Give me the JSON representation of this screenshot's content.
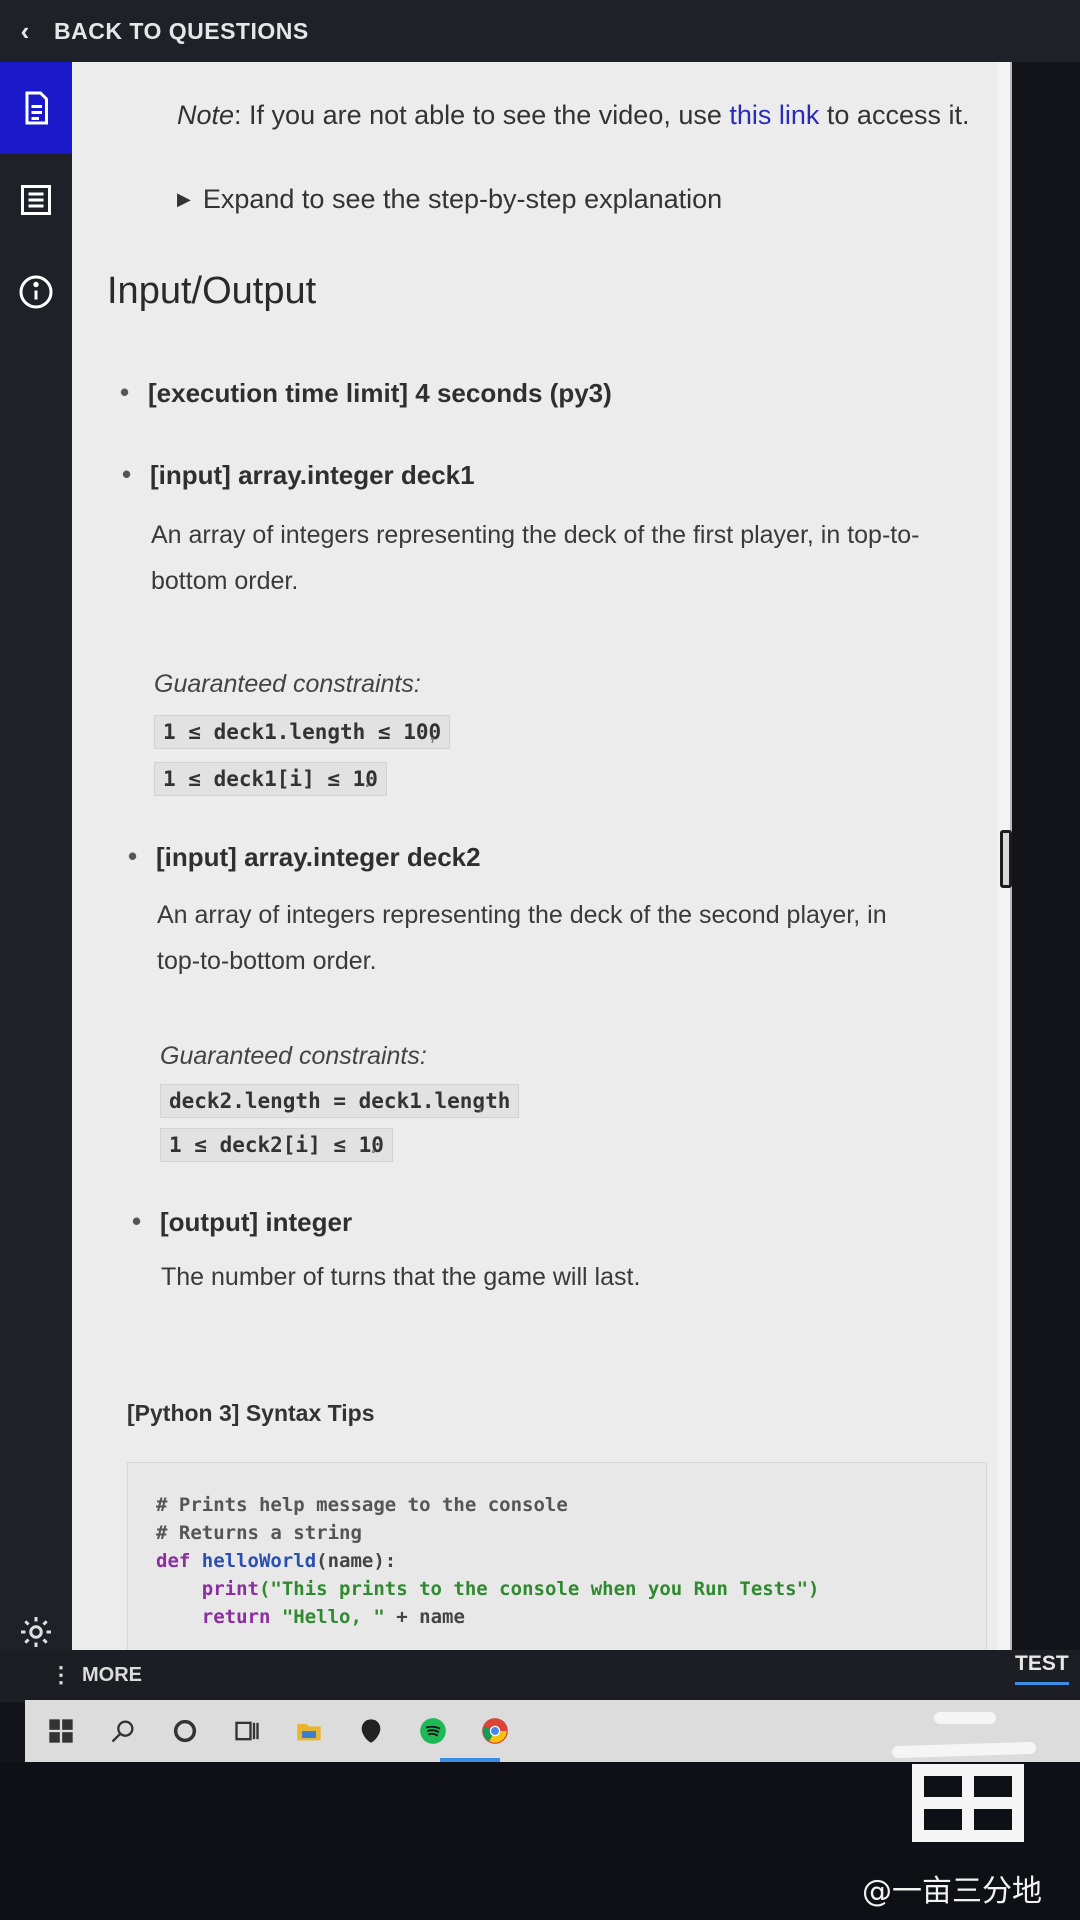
{
  "topbar": {
    "back_label": "BACK TO QUESTIONS"
  },
  "note": {
    "prefix": "Note",
    "text": ": If you are not able to see the video, use ",
    "link": "this link",
    "suffix": " to access it."
  },
  "expand": {
    "label": "Expand to see the step-by-step explanation"
  },
  "io": {
    "heading": "Input/Output",
    "time_limit": "[execution time limit] 4 seconds (py3)",
    "input1": {
      "label": "[input] array.integer deck1",
      "desc_line1": "An array of integers representing the deck of the first player, in top-to-",
      "desc_line2": "bottom order.",
      "constraints_label": "Guaranteed constraints:",
      "c1": "1 ≤ deck1.length ≤ 100",
      "c2": "1 ≤ deck1[i] ≤ 10"
    },
    "input2": {
      "label": "[input] array.integer deck2",
      "desc_line1": "An array of integers representing the deck of the second player, in",
      "desc_line2": "top-to-bottom order.",
      "constraints_label": "Guaranteed constraints:",
      "c1": "deck2.length = deck1.length",
      "c2": "1 ≤ deck2[i] ≤ 10"
    },
    "output": {
      "label": "[output] integer",
      "desc": "The number of turns that the game will last."
    }
  },
  "syntax": {
    "title": "[Python 3] Syntax Tips",
    "line1": "# Prints help message to the console",
    "line2": "# Returns a string",
    "line3_kw": "def",
    "line3_fn": "helloWorld",
    "line3_rest": "(name):",
    "line4_kw": "print",
    "line4_str": "(\"This prints to the console when you Run Tests\")",
    "line5_kw": "return",
    "line5_str": "\"Hello, \"",
    "line5_rest": " + name"
  },
  "morebar": {
    "more_label": "MORE",
    "test_label": "TEST"
  },
  "watermark": {
    "text": "@一亩三分地"
  },
  "icons": [
    "back-icon",
    "description-icon",
    "list-icon",
    "info-icon",
    "settings-icon",
    "windows-icon",
    "search-icon",
    "cortana-icon",
    "task-view-icon",
    "file-explorer-icon",
    "alienware-icon",
    "spotify-icon",
    "chrome-icon"
  ],
  "colors": {
    "rail_active": "#1a18c8",
    "link": "#2b2bb8",
    "accent": "#3a8ee6"
  }
}
